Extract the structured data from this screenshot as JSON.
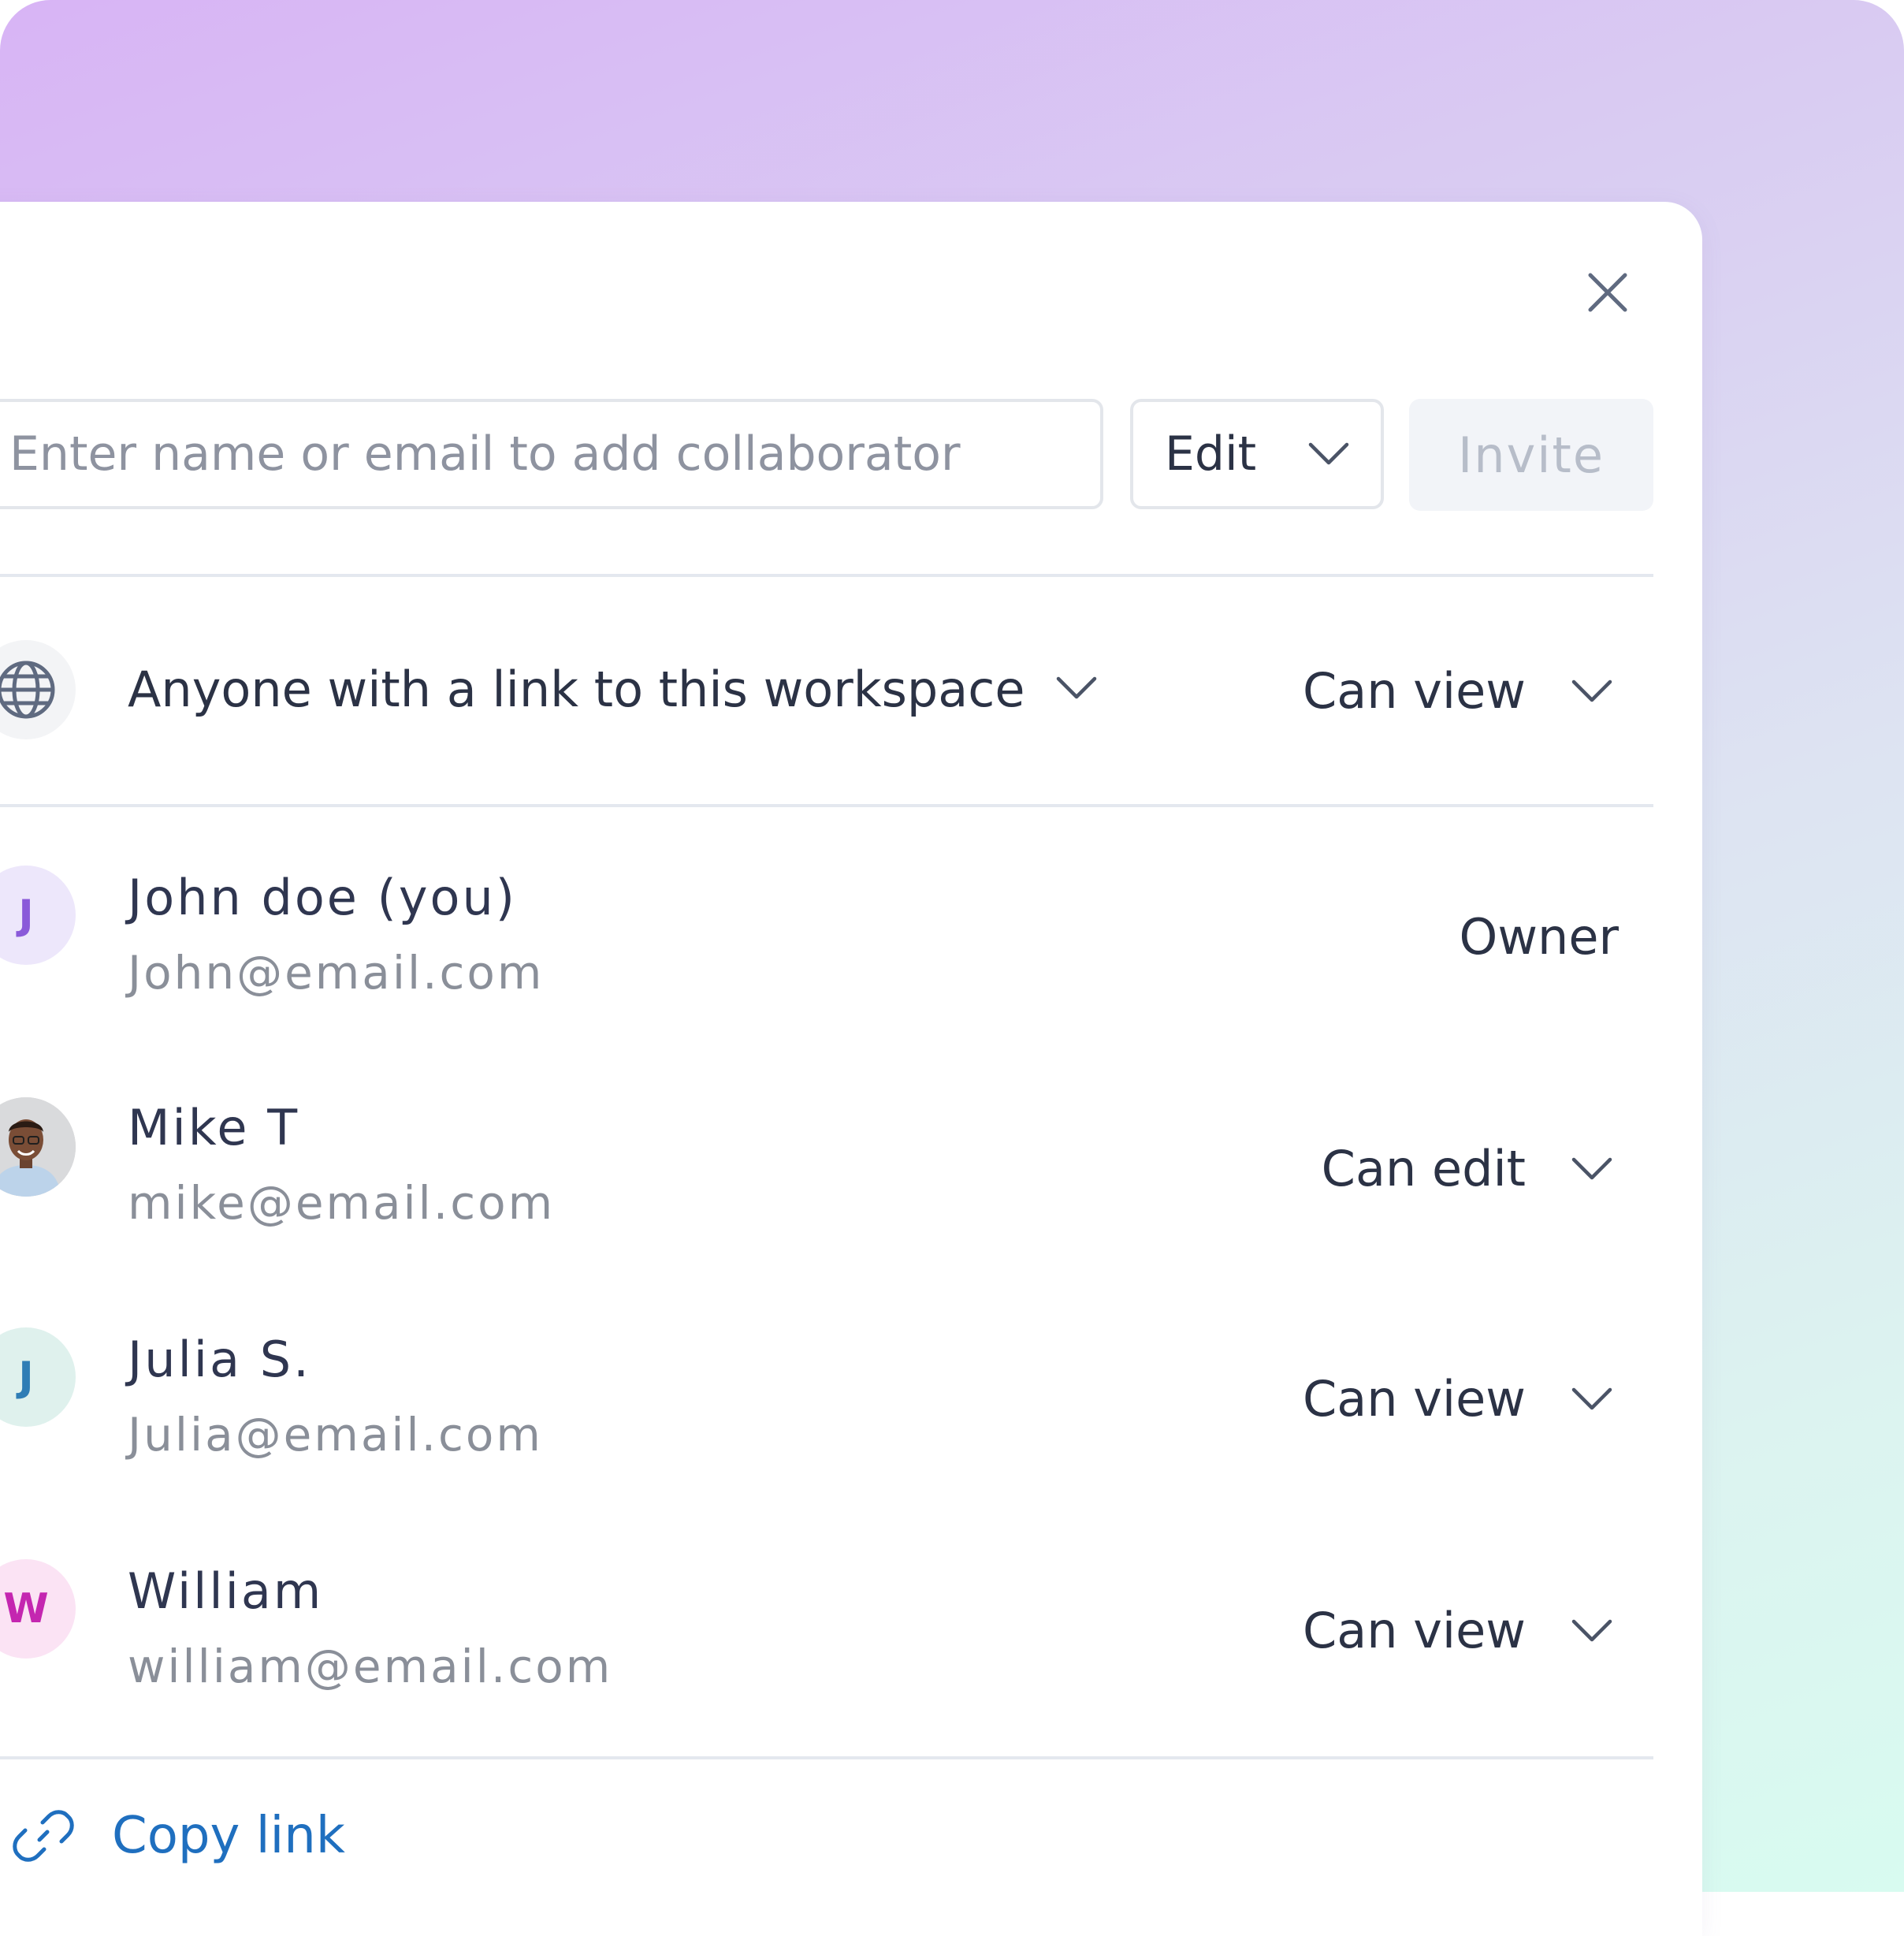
{
  "dialog": {
    "close_icon": "close-icon"
  },
  "invite_bar": {
    "placeholder": "Enter name or email to add collaborator",
    "role_selected": "Edit",
    "invite_label": "Invite"
  },
  "link_share": {
    "icon": "globe-icon",
    "label": "Anyone with a link to this workspace",
    "permission": "Can view"
  },
  "members": [
    {
      "initial": "J",
      "name": "John doe (you)",
      "email": "John@email.com",
      "role": "Owner",
      "avatar_bg": "#ede7fb",
      "avatar_color": "#8a5ad9"
    },
    {
      "initial": "",
      "name": "Mike T",
      "email": "mike@email.com",
      "role": "Can edit",
      "avatar": "photo"
    },
    {
      "initial": "J",
      "name": "Julia S.",
      "email": "Julia@email.com",
      "role": "Can view",
      "avatar_bg": "#dff1ed",
      "avatar_color": "#2f7db5"
    },
    {
      "initial": "W",
      "name": "William",
      "email": "william@email.com",
      "role": "Can view",
      "avatar_bg": "#fbe3f4",
      "avatar_color": "#c426b0"
    }
  ],
  "footer": {
    "copy_label": "Copy link",
    "icon": "link-icon"
  },
  "colors": {
    "accent_link": "#1f6fbf",
    "text_primary": "#2b3245",
    "text_secondary": "#8a8f99"
  }
}
